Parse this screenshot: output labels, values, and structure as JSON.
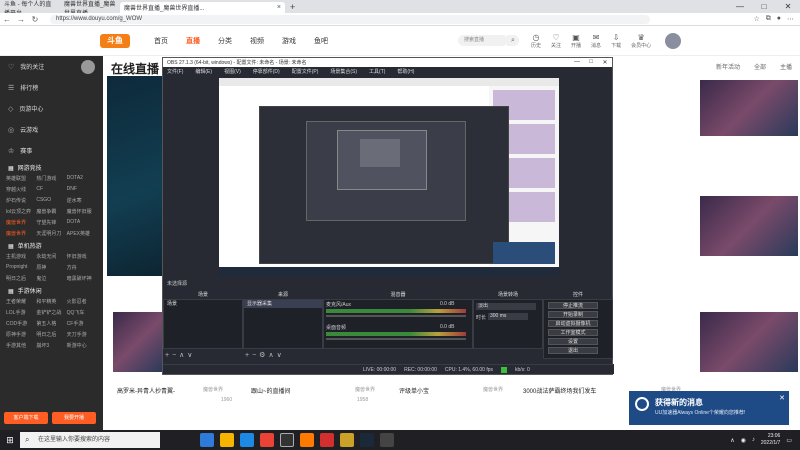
{
  "browser": {
    "tabs": [
      {
        "title": "斗鱼 - 每个人的直播平台"
      },
      {
        "title": "魔兽世界直播_魔兽世界直播..."
      },
      {
        "title": "魔兽世界直播_魔兽世界直播..."
      }
    ],
    "url": "https://www.douyu.com/g_WOW"
  },
  "douyu": {
    "logo": "斗鱼",
    "nav": [
      "首页",
      "直播",
      "分类",
      "视频",
      "游戏",
      "鱼吧"
    ],
    "active_nav": "直播",
    "search_placeholder": "搜索直播",
    "header_icons": [
      "历史",
      "关注",
      "开播",
      "消息",
      "下载",
      "会员中心"
    ],
    "live_title": "在线直播",
    "right_links": [
      "新年活动",
      "全部",
      "主播"
    ]
  },
  "sidebar": {
    "items": [
      {
        "icon": "heart-icon",
        "label": "我的关注"
      },
      {
        "icon": "list-icon",
        "label": "排行榜"
      },
      {
        "icon": "gift-icon",
        "label": "页游中心"
      },
      {
        "icon": "gamepad-icon",
        "label": "云游戏"
      },
      {
        "icon": "trophy-icon",
        "label": "赛事"
      }
    ],
    "sections": [
      {
        "title": "网游竞技",
        "items": [
          "英雄联盟",
          "热门游戏",
          "DOTA2",
          "穿越火线",
          "CF",
          "DNF",
          "炉石传说",
          "CSGO",
          "逆水寒",
          "lol云顶之弈",
          "魔兽争霸",
          "魔兽怀旧服",
          "魔兽世界",
          "守望先锋",
          "DOTA",
          "魔兽世界",
          "天涯明月刀",
          "APEX英雄"
        ]
      },
      {
        "title": "单机热游",
        "items": [
          "主机游戏",
          "永劫无间",
          "怀旧游戏",
          "Propnight",
          "原神",
          "方舟",
          "明日之后",
          "鬼泣",
          "暗黑破坏神"
        ]
      },
      {
        "title": "手游休闲",
        "items": [
          "王者荣耀",
          "和平精英",
          "火影忍者",
          "LOL手游",
          "金铲铲之战",
          "QQ飞车",
          "COD手游",
          "第五人格",
          "CF手游",
          "原神手游",
          "明日之后",
          "天刀手游",
          "手游其他",
          "崩坏3",
          "新游中心"
        ]
      }
    ],
    "bottom_buttons": [
      "客户端下载",
      "我要开播"
    ]
  },
  "obs": {
    "title": "OBS 27.1.3 (64-bit, windows) - 配置文件: 未命名 - 场景: 未命名",
    "menu": [
      "文件(F)",
      "编辑(E)",
      "视图(V)",
      "停靠部件(D)",
      "配置文件(P)",
      "场景集合(S)",
      "工具(T)",
      "帮助(H)"
    ],
    "status_row": "未选择源",
    "docks": {
      "scenes": {
        "title": "场景",
        "items": [
          "场景"
        ]
      },
      "sources": {
        "title": "来源",
        "items": [
          "显示器采集"
        ]
      },
      "mixer": {
        "title": "混音器",
        "channels": [
          {
            "name": "麦克风/Aux",
            "db": "0.0 dB"
          },
          {
            "name": "桌面音频",
            "db": "0.0 dB"
          }
        ]
      },
      "transitions": {
        "title": "场景转场",
        "type": "淡出",
        "duration_label": "时长",
        "duration": "300 ms"
      },
      "controls": {
        "title": "控件",
        "buttons": [
          "停止推流",
          "开始录制",
          "启动虚拟摄像机",
          "工作室模式",
          "设置",
          "退出"
        ]
      }
    },
    "statusbar": {
      "live": "LIVE: 00:00:00",
      "rec": "REC: 00:00:00",
      "cpu": "CPU: 1.4%, 60.00 fps",
      "bitrate": "kb/s: 0"
    }
  },
  "cards": [
    {
      "title": "高罗米-异青人抄青翼-",
      "sub": "魔兽世界",
      "count": "1960"
    },
    {
      "title": "跟山~的直播间",
      "sub": "魔兽世界",
      "count": "1958"
    },
    {
      "title": "评级单小宝",
      "sub": "魔兽世界",
      "count": ""
    },
    {
      "title": "3000战法萨霸终场我们发车",
      "sub": "魔兽世界",
      "count": ""
    }
  ],
  "toast": {
    "title": "获得新的消息",
    "body": "UU加速器Always Online个荣耀向您推荐!"
  },
  "taskbar": {
    "search": "在这里输入你要搜索的内容",
    "time": "23:06",
    "date": "2022/1/7"
  }
}
